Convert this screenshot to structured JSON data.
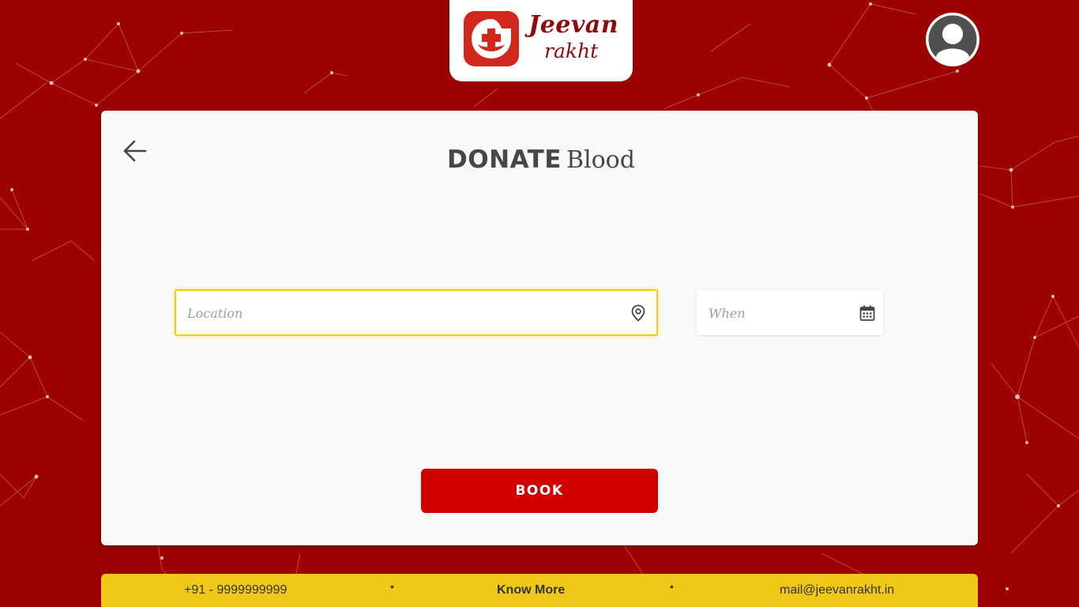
{
  "brand": {
    "name_line1": "Jeevan",
    "name_line2": "rakht",
    "logo_icon": "medical-cross-icon",
    "color_primary": "#9c0200",
    "color_dark_red": "#8e0b0b",
    "color_accent_yellow": "#f0c918"
  },
  "header": {
    "avatar_icon": "user-avatar-icon"
  },
  "page": {
    "back_icon": "arrow-left-icon",
    "title_bold": "DONATE",
    "title_light": "Blood"
  },
  "form": {
    "location_placeholder": "Location",
    "location_value": "",
    "location_icon": "map-pin-icon",
    "when_placeholder": "When",
    "when_value": "",
    "when_icon": "calendar-icon",
    "submit_label": "BOOK",
    "submit_color": "#d10000"
  },
  "footer": {
    "phone": "+91 - 9999999999",
    "know_more": "Know More",
    "email": "mail@jeevanrakht.in",
    "separator": "•"
  }
}
